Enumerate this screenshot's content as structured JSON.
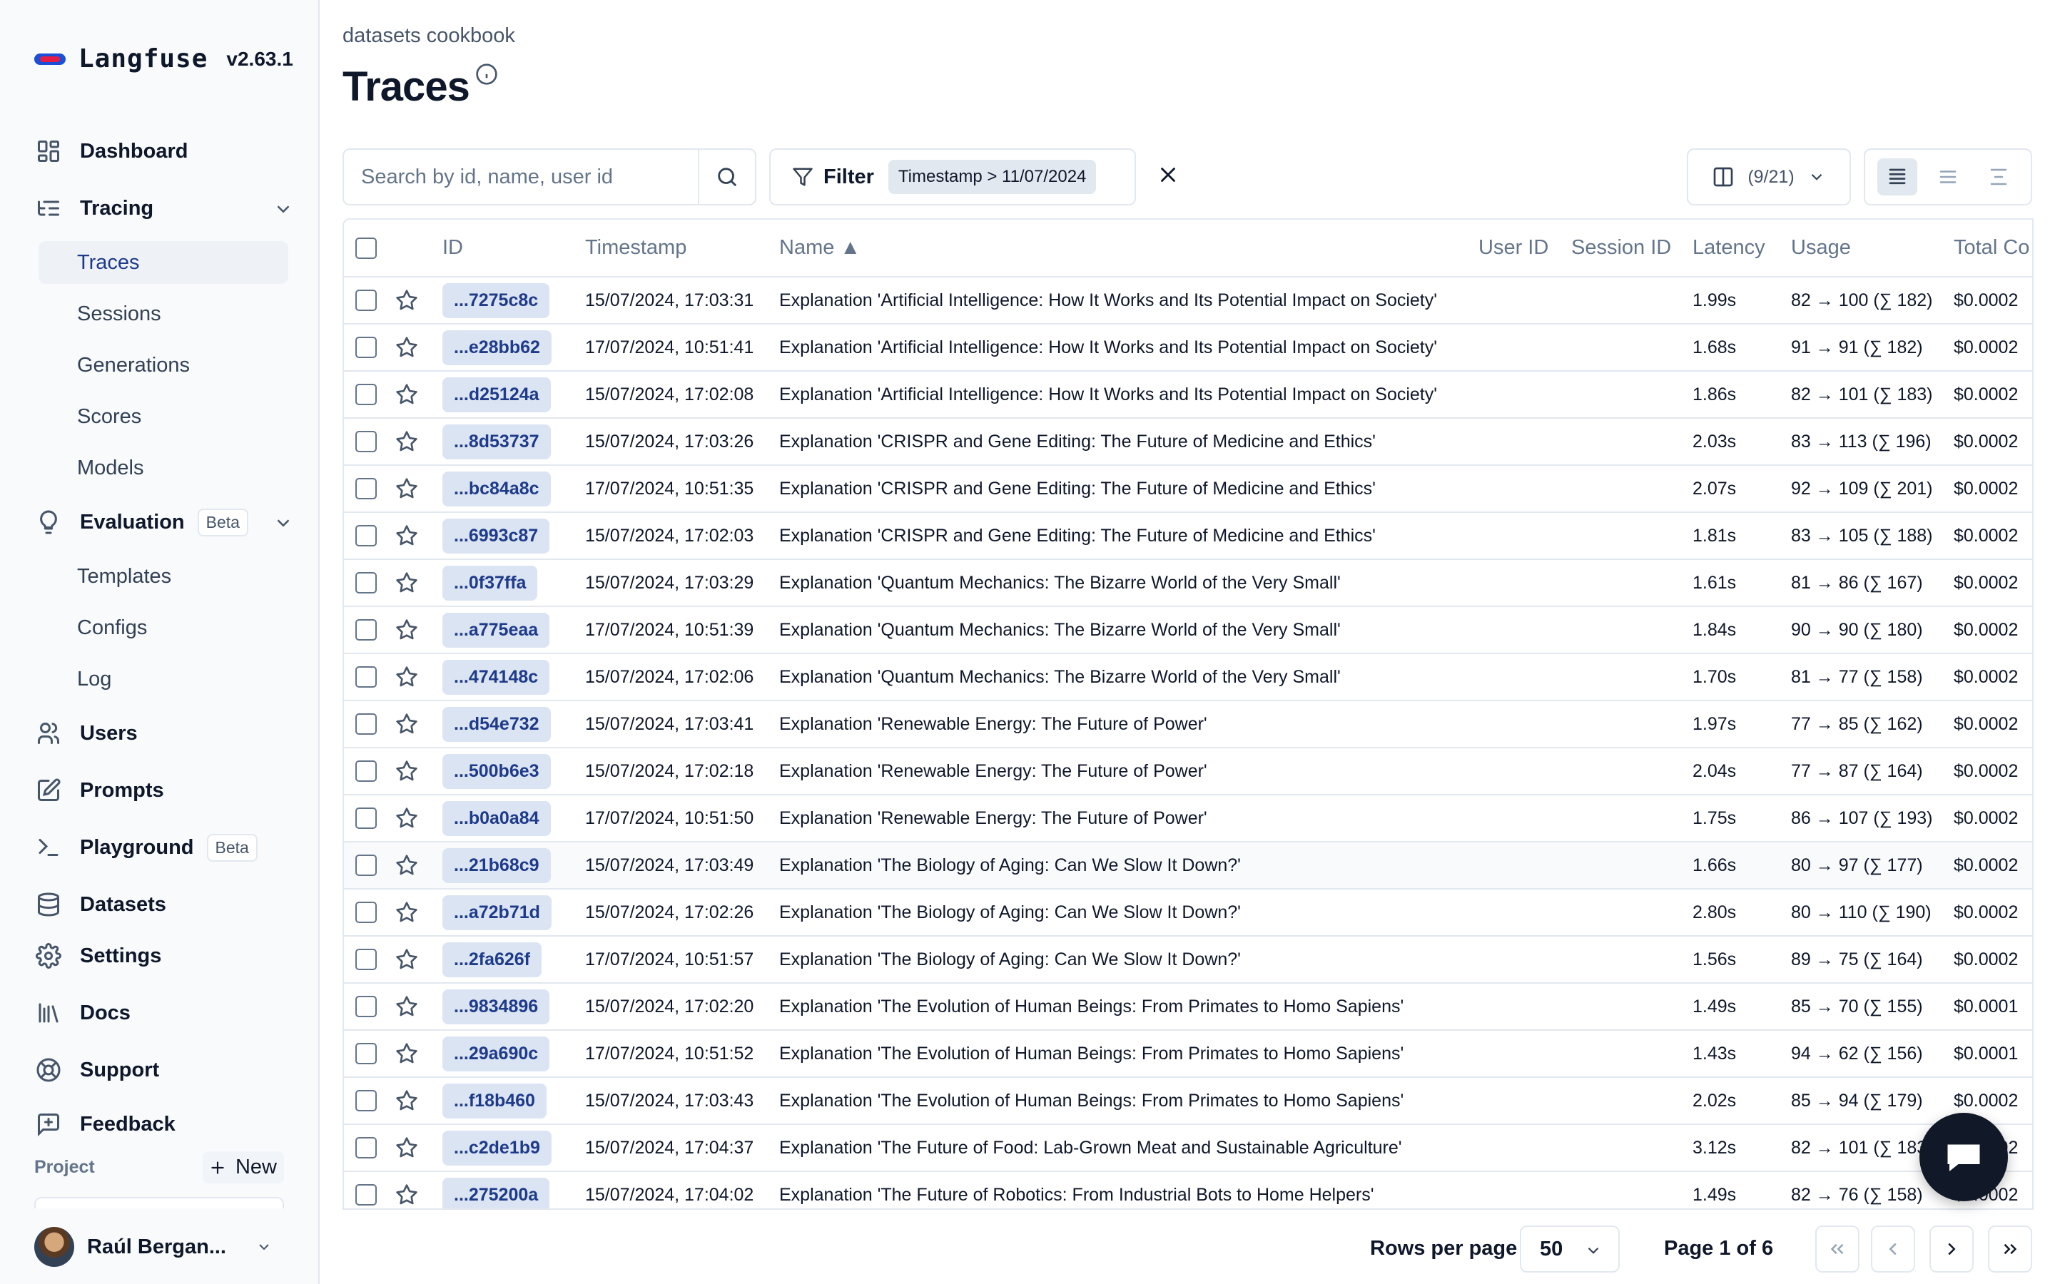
{
  "brand": {
    "name": "Langfuse",
    "version": "v2.63.1"
  },
  "sidebar": {
    "dashboard": "Dashboard",
    "tracing": "Tracing",
    "tracing_items": {
      "traces": "Traces",
      "sessions": "Sessions",
      "generations": "Generations",
      "scores": "Scores",
      "models": "Models"
    },
    "evaluation": "Evaluation",
    "evaluation_badge": "Beta",
    "evaluation_items": {
      "templates": "Templates",
      "configs": "Configs",
      "log": "Log"
    },
    "users": "Users",
    "prompts": "Prompts",
    "playground": "Playground",
    "playground_badge": "Beta",
    "datasets": "Datasets",
    "settings": "Settings",
    "docs": "Docs",
    "support": "Support",
    "feedback": "Feedback",
    "project_label": "Project",
    "new_label": "New",
    "user_name": "Raúl Bergan..."
  },
  "header": {
    "breadcrumb": "datasets cookbook",
    "title": "Traces"
  },
  "toolbar": {
    "search_placeholder": "Search by id, name, user id",
    "filter_label": "Filter",
    "filter_chip": "Timestamp > 11/07/2024",
    "columns_label": "(9/21)"
  },
  "table": {
    "columns": {
      "id": "ID",
      "timestamp": "Timestamp",
      "name": "Name ▲",
      "user_id": "User ID",
      "session_id": "Session ID",
      "latency": "Latency",
      "usage": "Usage",
      "total_cost": "Total Co"
    },
    "rows": [
      {
        "id": "...7275c8c",
        "timestamp": "15/07/2024, 17:03:31",
        "name": "Explanation 'Artificial Intelligence: How It Works and Its Potential Impact on Society'",
        "latency": "1.99s",
        "usage": "82 → 100 (∑ 182)",
        "cost": "$0.0002"
      },
      {
        "id": "...e28bb62",
        "timestamp": "17/07/2024, 10:51:41",
        "name": "Explanation 'Artificial Intelligence: How It Works and Its Potential Impact on Society'",
        "latency": "1.68s",
        "usage": "91 → 91 (∑ 182)",
        "cost": "$0.0002"
      },
      {
        "id": "...d25124a",
        "timestamp": "15/07/2024, 17:02:08",
        "name": "Explanation 'Artificial Intelligence: How It Works and Its Potential Impact on Society'",
        "latency": "1.86s",
        "usage": "82 → 101 (∑ 183)",
        "cost": "$0.0002"
      },
      {
        "id": "...8d53737",
        "timestamp": "15/07/2024, 17:03:26",
        "name": "Explanation 'CRISPR and Gene Editing: The Future of Medicine and Ethics'",
        "latency": "2.03s",
        "usage": "83 → 113 (∑ 196)",
        "cost": "$0.0002"
      },
      {
        "id": "...bc84a8c",
        "timestamp": "17/07/2024, 10:51:35",
        "name": "Explanation 'CRISPR and Gene Editing: The Future of Medicine and Ethics'",
        "latency": "2.07s",
        "usage": "92 → 109 (∑ 201)",
        "cost": "$0.0002"
      },
      {
        "id": "...6993c87",
        "timestamp": "15/07/2024, 17:02:03",
        "name": "Explanation 'CRISPR and Gene Editing: The Future of Medicine and Ethics'",
        "latency": "1.81s",
        "usage": "83 → 105 (∑ 188)",
        "cost": "$0.0002"
      },
      {
        "id": "...0f37ffa",
        "timestamp": "15/07/2024, 17:03:29",
        "name": "Explanation 'Quantum Mechanics: The Bizarre World of the Very Small'",
        "latency": "1.61s",
        "usage": "81 → 86 (∑ 167)",
        "cost": "$0.0002"
      },
      {
        "id": "...a775eaa",
        "timestamp": "17/07/2024, 10:51:39",
        "name": "Explanation 'Quantum Mechanics: The Bizarre World of the Very Small'",
        "latency": "1.84s",
        "usage": "90 → 90 (∑ 180)",
        "cost": "$0.0002"
      },
      {
        "id": "...474148c",
        "timestamp": "15/07/2024, 17:02:06",
        "name": "Explanation 'Quantum Mechanics: The Bizarre World of the Very Small'",
        "latency": "1.70s",
        "usage": "81 → 77 (∑ 158)",
        "cost": "$0.0002"
      },
      {
        "id": "...d54e732",
        "timestamp": "15/07/2024, 17:03:41",
        "name": "Explanation 'Renewable Energy: The Future of Power'",
        "latency": "1.97s",
        "usage": "77 → 85 (∑ 162)",
        "cost": "$0.0002"
      },
      {
        "id": "...500b6e3",
        "timestamp": "15/07/2024, 17:02:18",
        "name": "Explanation 'Renewable Energy: The Future of Power'",
        "latency": "2.04s",
        "usage": "77 → 87 (∑ 164)",
        "cost": "$0.0002"
      },
      {
        "id": "...b0a0a84",
        "timestamp": "17/07/2024, 10:51:50",
        "name": "Explanation 'Renewable Energy: The Future of Power'",
        "latency": "1.75s",
        "usage": "86 → 107 (∑ 193)",
        "cost": "$0.0002"
      },
      {
        "id": "...21b68c9",
        "timestamp": "15/07/2024, 17:03:49",
        "name": "Explanation 'The Biology of Aging: Can We Slow It Down?'",
        "latency": "1.66s",
        "usage": "80 → 97 (∑ 177)",
        "cost": "$0.0002"
      },
      {
        "id": "...a72b71d",
        "timestamp": "15/07/2024, 17:02:26",
        "name": "Explanation 'The Biology of Aging: Can We Slow It Down?'",
        "latency": "2.80s",
        "usage": "80 → 110 (∑ 190)",
        "cost": "$0.0002"
      },
      {
        "id": "...2fa626f",
        "timestamp": "17/07/2024, 10:51:57",
        "name": "Explanation 'The Biology of Aging: Can We Slow It Down?'",
        "latency": "1.56s",
        "usage": "89 → 75 (∑ 164)",
        "cost": "$0.0002"
      },
      {
        "id": "...9834896",
        "timestamp": "15/07/2024, 17:02:20",
        "name": "Explanation 'The Evolution of Human Beings: From Primates to Homo Sapiens'",
        "latency": "1.49s",
        "usage": "85 → 70 (∑ 155)",
        "cost": "$0.0001"
      },
      {
        "id": "...29a690c",
        "timestamp": "17/07/2024, 10:51:52",
        "name": "Explanation 'The Evolution of Human Beings: From Primates to Homo Sapiens'",
        "latency": "1.43s",
        "usage": "94 → 62 (∑ 156)",
        "cost": "$0.0001"
      },
      {
        "id": "...f18b460",
        "timestamp": "15/07/2024, 17:03:43",
        "name": "Explanation 'The Evolution of Human Beings: From Primates to Homo Sapiens'",
        "latency": "2.02s",
        "usage": "85 → 94 (∑ 179)",
        "cost": "$0.0002"
      },
      {
        "id": "...c2de1b9",
        "timestamp": "15/07/2024, 17:04:37",
        "name": "Explanation 'The Future of Food: Lab-Grown Meat and Sustainable Agriculture'",
        "latency": "3.12s",
        "usage": "82 → 101 (∑ 183)",
        "cost": "$0.0002"
      },
      {
        "id": "...275200a",
        "timestamp": "15/07/2024, 17:04:02",
        "name": "Explanation 'The Future of Robotics: From Industrial Bots to Home Helpers'",
        "latency": "1.49s",
        "usage": "82 → 76 (∑ 158)",
        "cost": "$0.0002"
      }
    ]
  },
  "pagination": {
    "rows_per_page_label": "Rows per page",
    "rows_per_page": "50",
    "page_label": "Page 1 of 6"
  }
}
